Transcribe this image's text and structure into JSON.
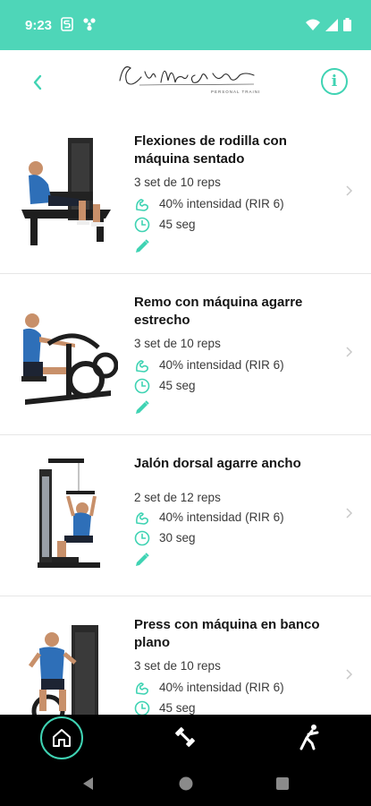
{
  "status_bar": {
    "time": "9:23",
    "bg_color": "#4ed6b8",
    "left_icons": [
      "s-icon",
      "fan-icon"
    ],
    "right_icons": [
      "wifi-icon",
      "signal-icon",
      "battery-icon"
    ]
  },
  "header": {
    "back_icon": "chevron-left-icon",
    "logo_text": "Eva María Cano",
    "logo_subtext": "personal trainer",
    "info_label": "i",
    "accent_color": "#3fd3b3"
  },
  "exercises": [
    {
      "title": "Flexiones de rodilla con máquina sentado",
      "sets": "3 set de 10 reps",
      "intensity": "40% intensidad (RIR 6)",
      "rest": "45 seg"
    },
    {
      "title": "Remo con máquina agarre estrecho",
      "sets": "3 set de 10 reps",
      "intensity": "40% intensidad (RIR 6)",
      "rest": "45 seg"
    },
    {
      "title": "Jalón dorsal agarre ancho",
      "sets": "2 set de 12 reps",
      "intensity": "40% intensidad (RIR 6)",
      "rest": "30 seg"
    },
    {
      "title": "Press con máquina en banco plano",
      "sets": "3 set de 10 reps",
      "intensity": "40% intensidad (RIR 6)",
      "rest": "45 seg"
    }
  ],
  "bottom_nav": {
    "tabs": [
      "home-icon",
      "dumbbell-icon",
      "stretch-icon"
    ],
    "active": "home-icon"
  },
  "system_nav": [
    "back-triangle-icon",
    "home-circle-icon",
    "recents-square-icon"
  ]
}
